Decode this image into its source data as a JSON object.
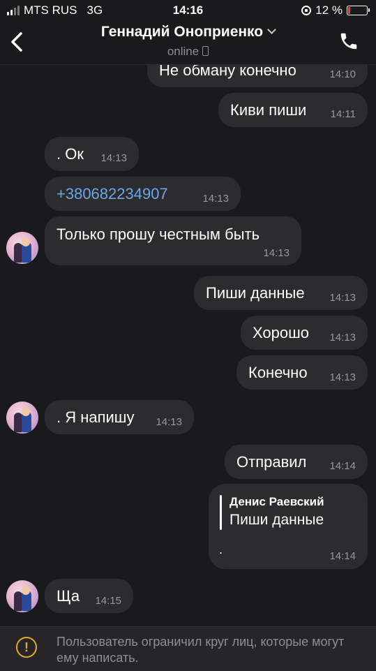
{
  "status_bar": {
    "carrier": "MTS RUS",
    "network": "3G",
    "time": "14:16",
    "battery": "12 %",
    "battery_level": 0.12,
    "battery_color": "#ff3b30"
  },
  "header": {
    "back_icon": "chevron-left-icon",
    "contact_name": "Геннадий Оноприенко",
    "status": "online",
    "call_icon": "phone-icon"
  },
  "messages": [
    {
      "side": "out",
      "text": "Не обману конечно",
      "time": "14:10"
    },
    {
      "side": "out",
      "text": "Киви пиши",
      "time": "14:11"
    },
    {
      "side": "in",
      "text": ". Ок",
      "time": "14:13"
    },
    {
      "side": "in",
      "text": "+380682234907",
      "time": "14:13",
      "type": "link"
    },
    {
      "side": "in",
      "text": "Только прошу честным  быть",
      "time": "14:13"
    },
    {
      "side": "out",
      "text": "Пиши данные",
      "time": "14:13"
    },
    {
      "side": "out",
      "text": "Хорошо",
      "time": "14:13"
    },
    {
      "side": "out",
      "text": "Конечно",
      "time": "14:13"
    },
    {
      "side": "in",
      "text": ". Я напишу",
      "time": "14:13"
    },
    {
      "side": "out",
      "text": "Отправил",
      "time": "14:14"
    },
    {
      "side": "out",
      "reply_author": "Денис Раевский",
      "reply_text": "Пиши данные",
      "text": ".",
      "time": "14:14"
    },
    {
      "side": "in",
      "text": "Ща",
      "time": "14:15"
    }
  ],
  "banner": {
    "icon": "warning-icon",
    "text": "Пользователь ограничил круг лиц, которые могут ему написать."
  },
  "colors": {
    "background": "#1a1a1c",
    "bubble": "#2c2c2e",
    "link": "#6aa6e8",
    "warning": "#e6a82e"
  }
}
